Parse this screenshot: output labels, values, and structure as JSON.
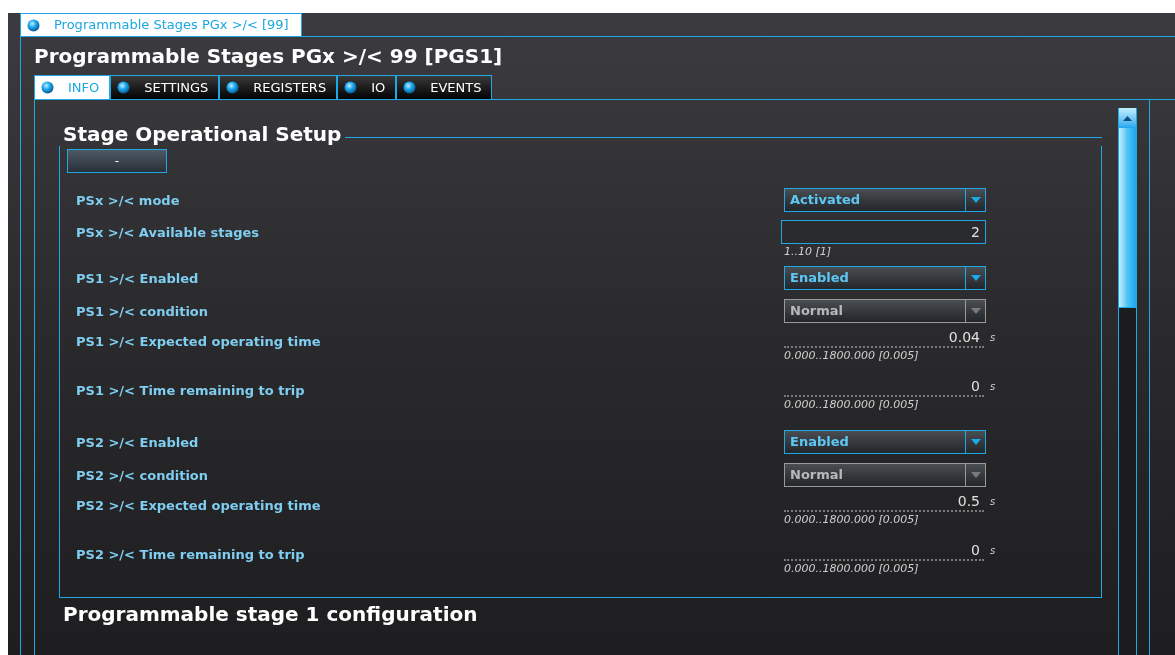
{
  "outer_tab": {
    "label": "Programmable Stages PGx >/< [99]",
    "selected": true
  },
  "title": "Programmable Stages PGx >/< 99 [PGS1]",
  "tabs": [
    {
      "label": "INFO",
      "selected": true
    },
    {
      "label": "SETTINGS",
      "selected": false
    },
    {
      "label": "REGISTERS",
      "selected": false
    },
    {
      "label": "IO",
      "selected": false
    },
    {
      "label": "EVENTS",
      "selected": false
    }
  ],
  "section": {
    "title": "Stage Operational Setup",
    "collapse_button": "-",
    "rows": [
      {
        "kind": "select",
        "label": "PSx >/< mode",
        "value": "Activated",
        "disabled": false
      },
      {
        "kind": "number",
        "label": "PSx >/< Available stages",
        "value": "2",
        "range": "1..10 [1]"
      },
      {
        "kind": "select",
        "label": "PS1 >/< Enabled",
        "value": "Enabled",
        "disabled": false
      },
      {
        "kind": "select",
        "label": "PS1 >/< condition",
        "value": "Normal",
        "disabled": true
      },
      {
        "kind": "reading",
        "label": "PS1 >/< Expected operating time",
        "value": "0.04",
        "unit": "s",
        "range": "0.000..1800.000 [0.005]"
      },
      {
        "kind": "reading",
        "label": "PS1 >/< Time remaining to trip",
        "value": "0",
        "unit": "s",
        "range": "0.000..1800.000 [0.005]"
      },
      {
        "kind": "select",
        "label": "PS2 >/< Enabled",
        "value": "Enabled",
        "disabled": false
      },
      {
        "kind": "select",
        "label": "PS2 >/< condition",
        "value": "Normal",
        "disabled": true
      },
      {
        "kind": "reading",
        "label": "PS2 >/< Expected operating time",
        "value": "0.5",
        "unit": "s",
        "range": "0.000..1800.000 [0.005]"
      },
      {
        "kind": "reading",
        "label": "PS2 >/< Time remaining to trip",
        "value": "0",
        "unit": "s",
        "range": "0.000..1800.000 [0.005]"
      }
    ]
  },
  "next_section": {
    "title": "Programmable stage 1 configuration"
  }
}
